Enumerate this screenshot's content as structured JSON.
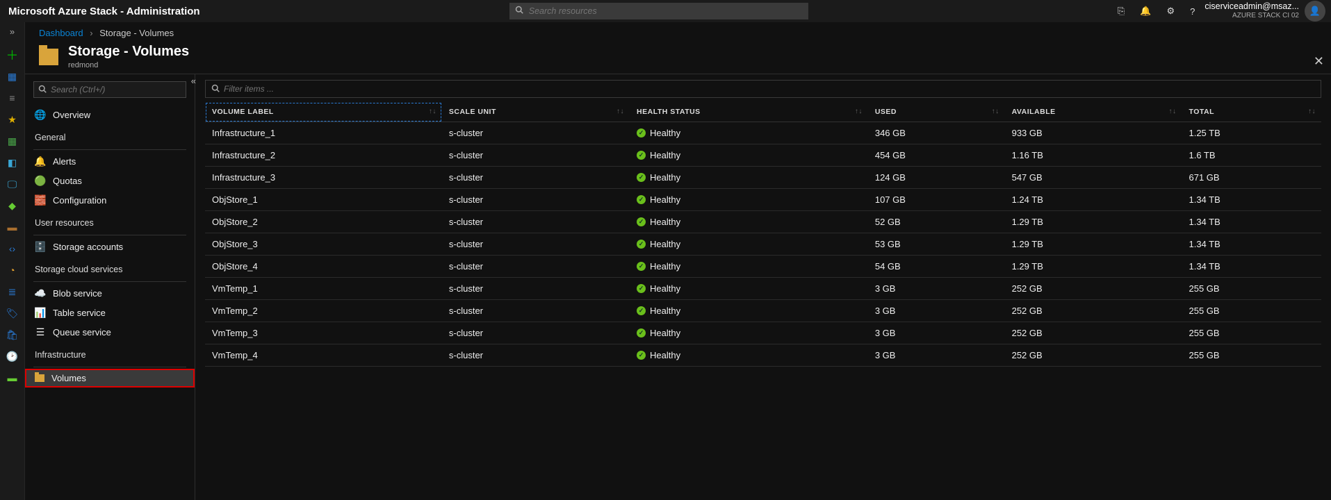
{
  "header": {
    "brand": "Microsoft Azure Stack - Administration",
    "search_placeholder": "Search resources",
    "user": "ciserviceadmin@msaz...",
    "tenant": "AZURE STACK CI 02"
  },
  "breadcrumb": {
    "root": "Dashboard",
    "current": "Storage - Volumes"
  },
  "page": {
    "title": "Storage - Volumes",
    "subtitle": "redmond",
    "nav_search_placeholder": "Search (Ctrl+/)",
    "filter_placeholder": "Filter items ..."
  },
  "nav": {
    "overview": "Overview",
    "groups": {
      "general": "General",
      "user_resources": "User resources",
      "storage_cloud_services": "Storage cloud services",
      "infrastructure": "Infrastructure"
    },
    "items": {
      "alerts": "Alerts",
      "quotas": "Quotas",
      "configuration": "Configuration",
      "storage_accounts": "Storage accounts",
      "blob_service": "Blob service",
      "table_service": "Table service",
      "queue_service": "Queue service",
      "volumes": "Volumes"
    }
  },
  "icons": {
    "overview": "🌐",
    "alerts": "🔔",
    "quotas": "🟢",
    "configuration": "🧱",
    "storage_accounts": "🗄️",
    "blob_service": "☁️",
    "table_service": "📊",
    "queue_service": "☰"
  },
  "columns": {
    "volume_label": "Volume Label",
    "scale_unit": "Scale Unit",
    "health_status": "Health Status",
    "used": "Used",
    "available": "Available",
    "total": "Total"
  },
  "health_label": "Healthy",
  "rows": [
    {
      "label": "Infrastructure_1",
      "scale": "s-cluster",
      "used": "346 GB",
      "avail": "933 GB",
      "total": "1.25 TB"
    },
    {
      "label": "Infrastructure_2",
      "scale": "s-cluster",
      "used": "454 GB",
      "avail": "1.16 TB",
      "total": "1.6 TB"
    },
    {
      "label": "Infrastructure_3",
      "scale": "s-cluster",
      "used": "124 GB",
      "avail": "547 GB",
      "total": "671 GB"
    },
    {
      "label": "ObjStore_1",
      "scale": "s-cluster",
      "used": "107 GB",
      "avail": "1.24 TB",
      "total": "1.34 TB"
    },
    {
      "label": "ObjStore_2",
      "scale": "s-cluster",
      "used": "52 GB",
      "avail": "1.29 TB",
      "total": "1.34 TB"
    },
    {
      "label": "ObjStore_3",
      "scale": "s-cluster",
      "used": "53 GB",
      "avail": "1.29 TB",
      "total": "1.34 TB"
    },
    {
      "label": "ObjStore_4",
      "scale": "s-cluster",
      "used": "54 GB",
      "avail": "1.29 TB",
      "total": "1.34 TB"
    },
    {
      "label": "VmTemp_1",
      "scale": "s-cluster",
      "used": "3 GB",
      "avail": "252 GB",
      "total": "255 GB"
    },
    {
      "label": "VmTemp_2",
      "scale": "s-cluster",
      "used": "3 GB",
      "avail": "252 GB",
      "total": "255 GB"
    },
    {
      "label": "VmTemp_3",
      "scale": "s-cluster",
      "used": "3 GB",
      "avail": "252 GB",
      "total": "255 GB"
    },
    {
      "label": "VmTemp_4",
      "scale": "s-cluster",
      "used": "3 GB",
      "avail": "252 GB",
      "total": "255 GB"
    }
  ]
}
